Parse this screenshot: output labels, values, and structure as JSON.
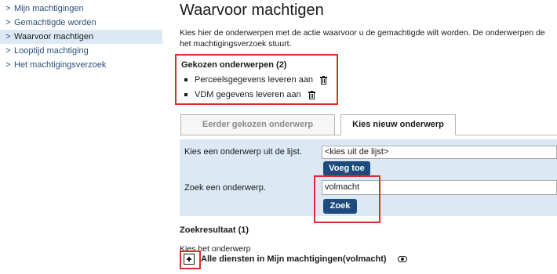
{
  "sidebar": {
    "items": [
      {
        "label": "Mijn machtigingen",
        "active": false
      },
      {
        "label": "Gemachtigde worden",
        "active": false
      },
      {
        "label": "Waarvoor machtigen",
        "active": true
      },
      {
        "label": "Looptijd machtiging",
        "active": false
      },
      {
        "label": "Het machtigingsverzoek",
        "active": false
      }
    ]
  },
  "main": {
    "title": "Waarvoor machtigen",
    "intro_line1": "Kies hier de onderwerpen met de actie waarvoor u de gemachtigde wilt worden. De onderwerpen de",
    "intro_line2": "het machtigingsverzoek stuurt.",
    "chosen": {
      "title": "Gekozen onderwerpen (2)",
      "items": [
        {
          "label": "Perceelsgegevens leveren aan",
          "icon": "trash-icon"
        },
        {
          "label": "VDM gegevens leveren aan",
          "icon": "trash-icon"
        }
      ]
    },
    "tabs": [
      {
        "label": "Eerder gekozen onderwerp",
        "active": false
      },
      {
        "label": "Kies nieuw onderwerp",
        "active": true
      }
    ],
    "form": {
      "select_label": "Kies een onderwerp uit de lijst.",
      "select_value": "<kies uit de lijst>",
      "add_button": "Voeg toe",
      "search_label": "Zoek een onderwerp.",
      "search_value": "volmacht",
      "search_button": "Zoek"
    },
    "results": {
      "title": "Zoekresultaat (1)",
      "hint": "Kies het onderwerp",
      "items": [
        {
          "label": "Alle diensten in Mijn machtigingen(volmacht)",
          "icon": "eye-icon"
        }
      ]
    }
  },
  "colors": {
    "link": "#2b4f7a",
    "active_nav_bg": "#dce9f5",
    "panel_bg": "#dce9f5",
    "button_bg": "#1e4b7d",
    "highlight_border": "#d9302c"
  }
}
